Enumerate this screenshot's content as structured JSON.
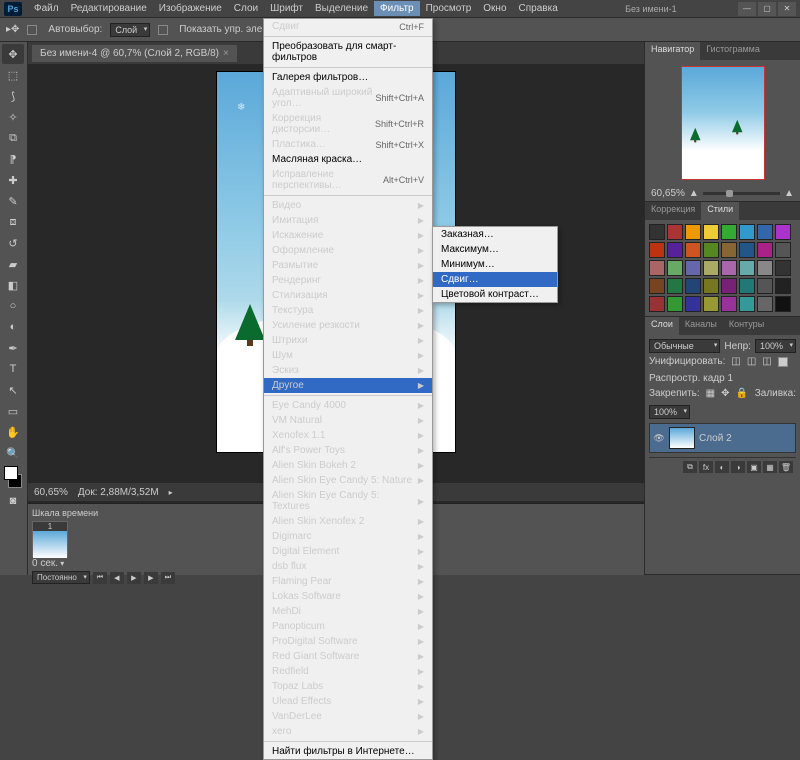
{
  "app": {
    "logo": "Ps",
    "doc_title": "Без имени-1"
  },
  "menubar": [
    "Файл",
    "Редактирование",
    "Изображение",
    "Слои",
    "Шрифт",
    "Выделение",
    "Фильтр",
    "Просмотр",
    "Окно",
    "Справка"
  ],
  "menubar_active": 6,
  "optionsbar": {
    "autoselect": "Автовыбор:",
    "autoselect_val": "Слой",
    "show_transform": "Показать упр. элем."
  },
  "doctab": {
    "label": "Без имени-4 @ 60,7% (Слой 2, RGB/8)"
  },
  "status": {
    "zoom": "60,65%",
    "docsize": "Док: 2,88M/3,52M"
  },
  "timeline": {
    "title": "Шкала времени",
    "frame_time": "0 сек.",
    "loop": "Постоянно",
    "frame_num": "1"
  },
  "panels": {
    "navigator": {
      "tab1": "Навигатор",
      "tab2": "Гистограмма",
      "zoom": "60,65%"
    },
    "styles": {
      "tab1": "Коррекция",
      "tab2": "Стили"
    },
    "layers": {
      "tab1": "Слои",
      "tab2": "Каналы",
      "tab3": "Контуры",
      "mode": "Обычные",
      "opacity_label": "Непр:",
      "opacity": "100%",
      "lock_label": "Закрепить:",
      "fill_label": "Заливка:",
      "fill": "100%",
      "uni_label": "Унифицировать:",
      "prop_label": "Распростр. кадр 1",
      "layer_name": "Слой 2"
    }
  },
  "filter_menu": {
    "last": {
      "label": "Сдвиг",
      "shortcut": "Ctrl+F"
    },
    "smart": "Преобразовать для смарт-фильтров",
    "gallery": "Галерея фильтров…",
    "adaptive": {
      "label": "Адаптивный широкий угол…",
      "shortcut": "Shift+Ctrl+A"
    },
    "lens": {
      "label": "Коррекция дисторсии…",
      "shortcut": "Shift+Ctrl+R"
    },
    "liquify": {
      "label": "Пластика…",
      "shortcut": "Shift+Ctrl+X"
    },
    "oil": "Масляная краска…",
    "vanish": {
      "label": "Исправление перспективы…",
      "shortcut": "Alt+Ctrl+V"
    },
    "groups": [
      "Видео",
      "Имитация",
      "Искажение",
      "Оформление",
      "Размытие",
      "Рендеринг",
      "Стилизация",
      "Текстура",
      "Усиление резкости",
      "Штрихи",
      "Шум",
      "Эскиз",
      "Другое"
    ],
    "groups_active": 12,
    "plugins": [
      "Eye Candy 4000",
      "VM Natural",
      "Xenofex 1.1",
      "Alf's Power Toys",
      "Alien Skin Bokeh 2",
      "Alien Skin Eye Candy 5: Nature",
      "Alien Skin Eye Candy 5: Textures",
      "Alien Skin Xenofex 2",
      "Digimarc",
      "Digital Element",
      "dsb flux",
      "Flaming Pear",
      "Lokas Software",
      "MehDi",
      "Panopticum",
      "ProDigital Software",
      "Red Giant Software",
      "Redfield",
      "Topaz Labs",
      "Ulead Effects",
      "VanDerLee",
      "xero"
    ],
    "browse": "Найти фильтры в Интернете…"
  },
  "submenu": {
    "items": [
      "Заказная…",
      "Максимум…",
      "Минимум…",
      "Сдвиг…",
      "Цветовой контраст…"
    ],
    "active": 3
  },
  "style_colors": [
    "#333",
    "#a33",
    "#e90",
    "#ec3",
    "#3a3",
    "#39c",
    "#36a",
    "#a3c",
    "#b31",
    "#529",
    "#c52",
    "#582",
    "#863",
    "#258",
    "#a28",
    "#555",
    "#a66",
    "#6a6",
    "#66a",
    "#aa6",
    "#a6a",
    "#6aa",
    "#888",
    "#333",
    "#742",
    "#274",
    "#247",
    "#772",
    "#727",
    "#277",
    "#555",
    "#222",
    "#933",
    "#393",
    "#339",
    "#993",
    "#939",
    "#399",
    "#666",
    "#111"
  ]
}
